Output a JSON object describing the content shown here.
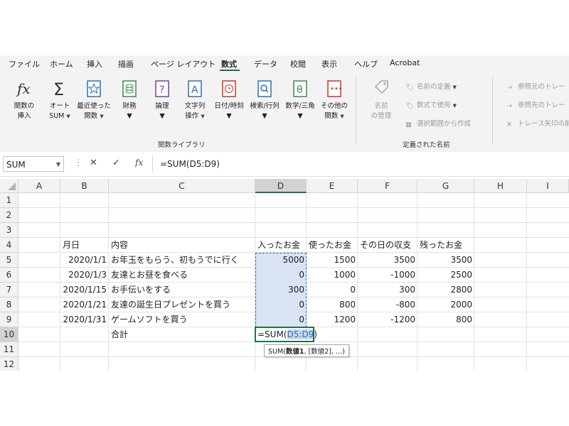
{
  "tabs": [
    "ファイル",
    "ホーム",
    "挿入",
    "描画",
    "ページ レイアウト",
    "数式",
    "データ",
    "校閲",
    "表示",
    "ヘルプ",
    "Acrobat"
  ],
  "active_tab": "数式",
  "ribbon": {
    "insert_function": {
      "line1": "関数の",
      "line2": "挿入"
    },
    "autosum": {
      "line1": "オート",
      "line2": "SUM"
    },
    "recent": {
      "line1": "最近使った",
      "line2": "関数"
    },
    "financial": {
      "line1": "財務"
    },
    "logical": {
      "line1": "論理"
    },
    "text": {
      "line1": "文字列",
      "line2": "操作"
    },
    "datetime": {
      "line1": "日付/時刻"
    },
    "lookup": {
      "line1": "検索/行列"
    },
    "math": {
      "line1": "数学/三角"
    },
    "more": {
      "line1": "その他の",
      "line2": "関数"
    },
    "group_function_library": "関数ライブラリ",
    "name_manager": {
      "line1": "名前",
      "line2": "の管理"
    },
    "define_name": "名前の定義",
    "use_in_formula": "数式で使用",
    "create_from_selection": "選択範囲から作成",
    "group_defined_names": "定義された名前",
    "trace_precedents": "参照元のトレー",
    "trace_dependents": "参照先のトレー",
    "remove_arrows": "トレース矢印の削"
  },
  "formula_bar": {
    "name_box": "SUM",
    "cancel": "✕",
    "enter": "✓",
    "fx": "fx",
    "formula": "=SUM(D5:D9)"
  },
  "columns": [
    "A",
    "B",
    "C",
    "D",
    "E",
    "F",
    "G",
    "H",
    "I"
  ],
  "rows": [
    "1",
    "2",
    "3",
    "4",
    "5",
    "6",
    "7",
    "8",
    "9",
    "10",
    "11",
    "12"
  ],
  "header_row": {
    "date": "月日",
    "content": "内容",
    "income": "入ったお金",
    "expense": "使ったお金",
    "balance": "その日の収支",
    "remaining": "残ったお金"
  },
  "data_rows": [
    {
      "date": "2020/1/1",
      "content": "お年玉をもらう、初もうでに行く",
      "income": "5000",
      "expense": "1500",
      "balance": "3500",
      "remaining": "3500"
    },
    {
      "date": "2020/1/3",
      "content": "友達とお昼を食べる",
      "income": "0",
      "expense": "1000",
      "balance": "-1000",
      "remaining": "2500"
    },
    {
      "date": "2020/1/15",
      "content": "お手伝いをする",
      "income": "300",
      "expense": "0",
      "balance": "300",
      "remaining": "2800"
    },
    {
      "date": "2020/1/21",
      "content": "友達の誕生日プレゼントを買う",
      "income": "0",
      "expense": "800",
      "balance": "-800",
      "remaining": "2000"
    },
    {
      "date": "2020/1/31",
      "content": "ゲームソフトを買う",
      "income": "0",
      "expense": "1200",
      "balance": "-1200",
      "remaining": "800"
    }
  ],
  "total_row": {
    "label": "合計",
    "formula_prefix": "=SUM(",
    "formula_ref": "D5:D9",
    "formula_suffix": ")"
  },
  "tooltip": {
    "prefix": "SUM(",
    "bold": "数値1",
    "rest": ", [数値2], ...)"
  },
  "colors": {
    "accent_green": "#217346",
    "range_fill": "#dae3f3",
    "range_border": "#2e6fb0"
  }
}
